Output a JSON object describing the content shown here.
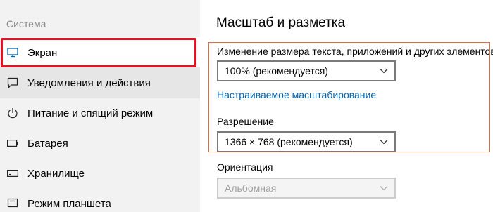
{
  "sidebar": {
    "header": "Система",
    "items": [
      {
        "label": "Экран",
        "icon": "monitor-icon"
      },
      {
        "label": "Уведомления и действия",
        "icon": "notification-icon"
      },
      {
        "label": "Питание и спящий режим",
        "icon": "power-icon"
      },
      {
        "label": "Батарея",
        "icon": "battery-icon"
      },
      {
        "label": "Хранилище",
        "icon": "storage-icon"
      },
      {
        "label": "Режим планшета",
        "icon": "tablet-mode-icon"
      }
    ]
  },
  "main": {
    "title": "Масштаб и разметка",
    "scale_label": "Изменение размера текста, приложений и других элементов",
    "scale_value": "100% (рекомендуется)",
    "custom_scaling_link": "Настраиваемое масштабирование",
    "resolution_label": "Разрешение",
    "resolution_value": "1366 × 768 (рекомендуется)",
    "orientation_label": "Ориентация",
    "orientation_value": "Альбомная"
  },
  "colors": {
    "accent_link": "#0063b1",
    "highlight_red": "#e81123",
    "highlight_orange": "#e26b3c",
    "sidebar_bg": "#f2f2f2"
  }
}
